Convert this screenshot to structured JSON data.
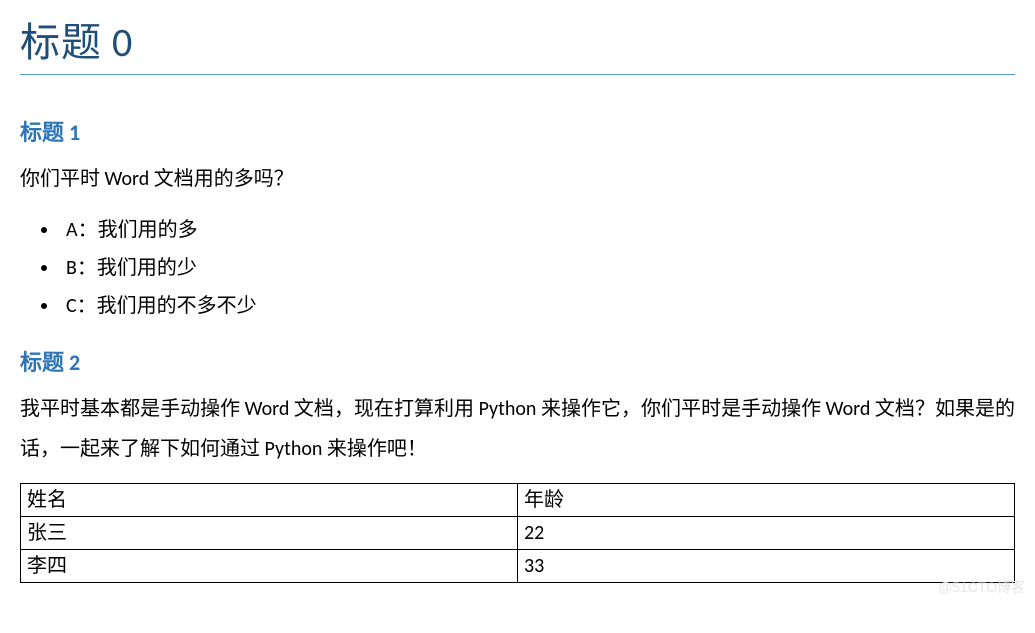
{
  "title0": "标题 0",
  "heading1": "标题 1",
  "question1": "你们平时 Word 文档用的多吗？",
  "options": [
    "A：我们用的多",
    "B：我们用的少",
    "C：我们用的不多不少"
  ],
  "heading2": "标题 2",
  "paragraph2": "我平时基本都是手动操作 Word 文档，现在打算利用 Python 来操作它，你们平时是手动操作 Word 文档？如果是的话，一起来了解下如何通过 Python 来操作吧！",
  "table": {
    "rows": [
      [
        "姓名",
        "年龄"
      ],
      [
        "张三",
        "22"
      ],
      [
        "李四",
        "33"
      ]
    ]
  },
  "watermark": "@51CTO博客"
}
